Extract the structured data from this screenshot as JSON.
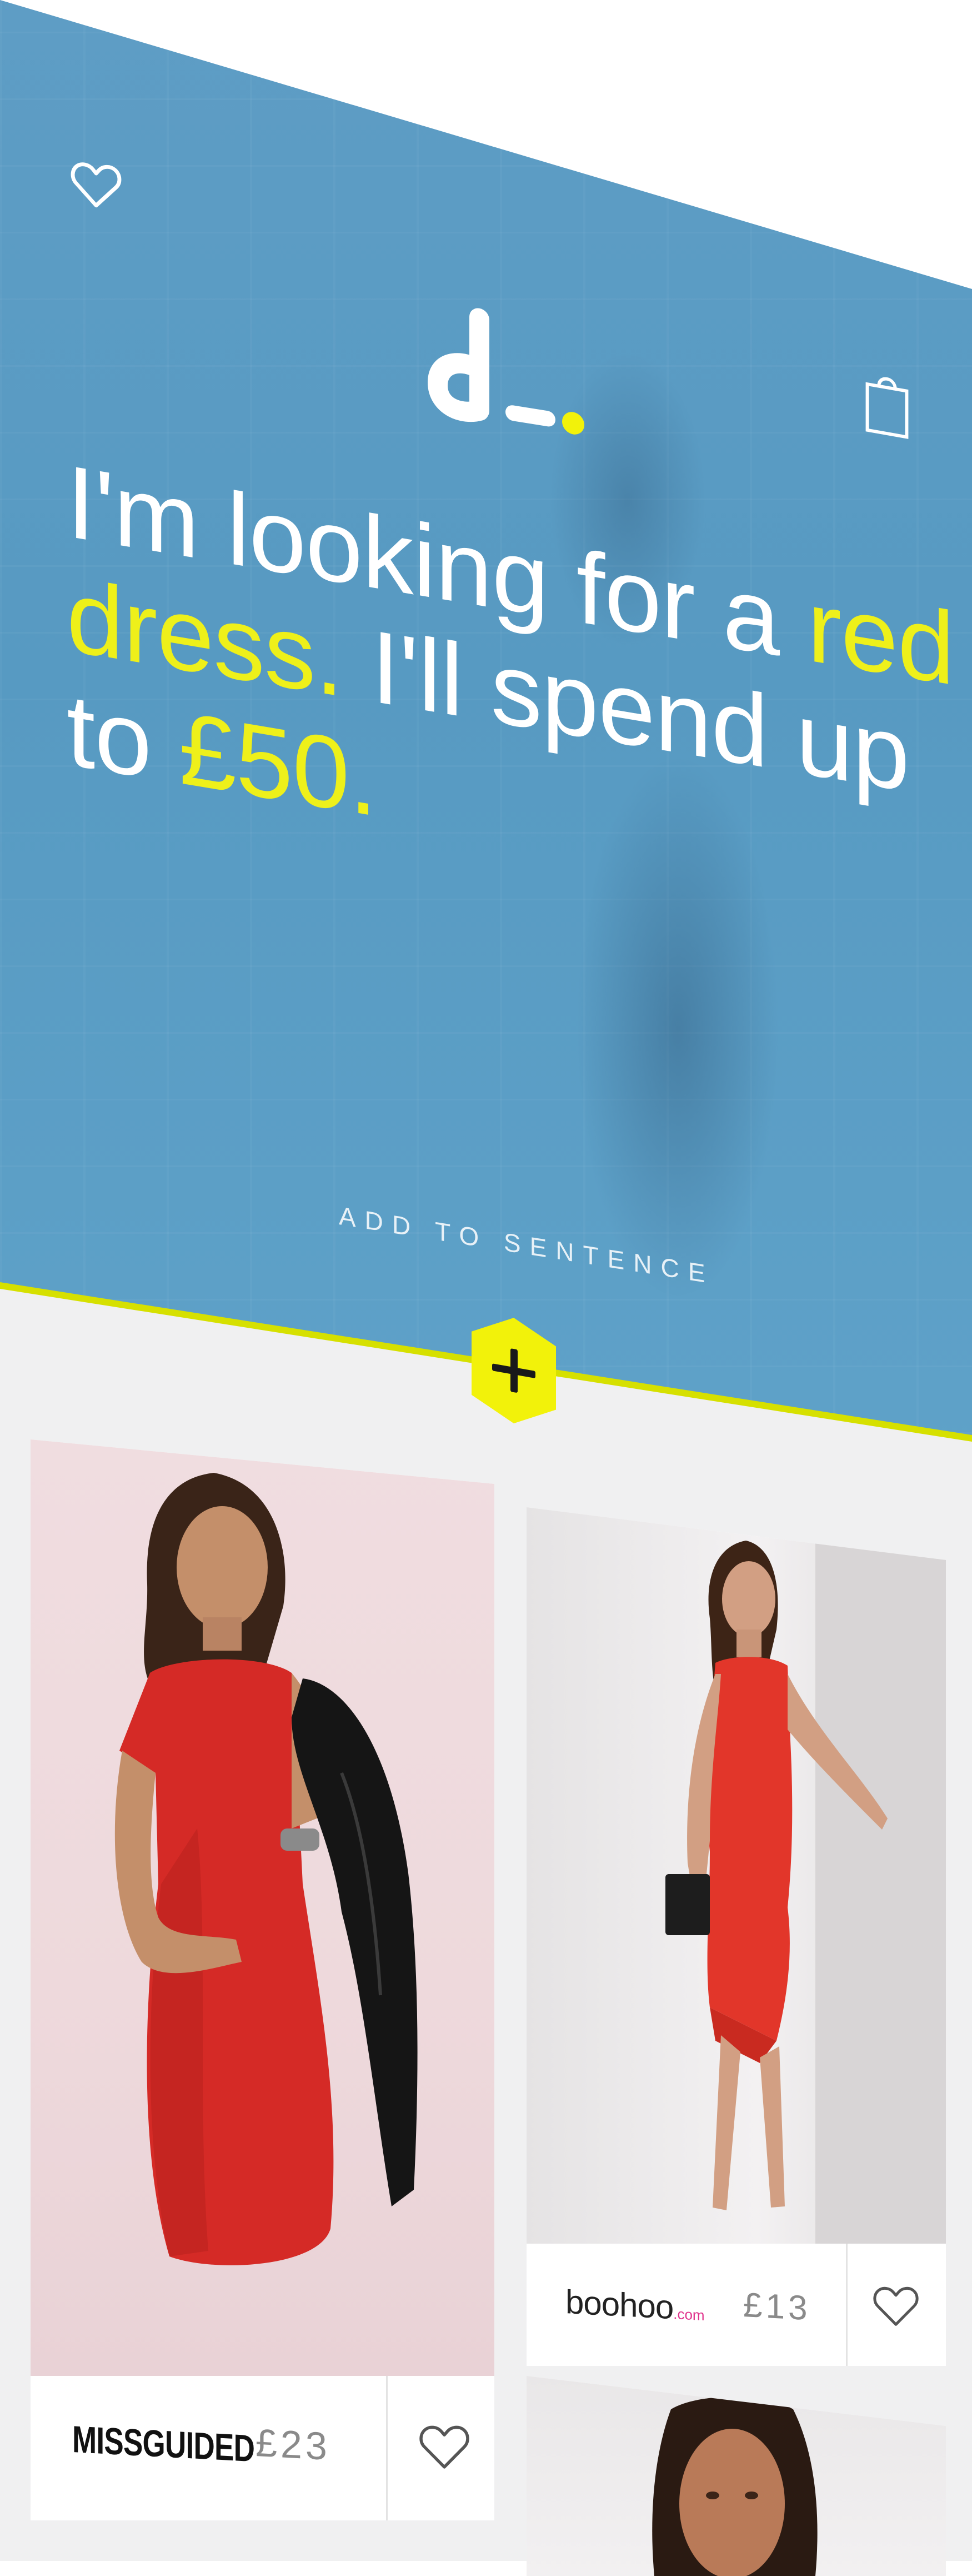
{
  "hero": {
    "sentence": {
      "line1": "I'm looking for a ",
      "line1_highlight": "red",
      "line2_highlight": "dress.",
      "line2": " I'll spend up",
      "line3": "to ",
      "line3_highlight": "£50."
    },
    "add_label": "ADD TO SENTENCE",
    "icons": {
      "favorites": "heart-outline-icon",
      "bag": "shopping-bag-icon",
      "logo": "d-logo",
      "add": "plus-icon"
    }
  },
  "colors": {
    "hero_blue": "#5e9dc5",
    "highlight_yellow": "#eef01a",
    "accent_yellow": "#f2f20a",
    "background": "#f0f0f1",
    "boohoo_pink": "#e0338c"
  },
  "products": [
    {
      "brand": "MISSGUIDED",
      "price": "£23",
      "favorite_icon": "heart-outline-icon",
      "image": "red-dress-with-jacket"
    },
    {
      "brand": "boohoo",
      "brand_suffix": ".com",
      "price": "£13",
      "favorite_icon": "heart-outline-icon",
      "image": "red-halter-dress"
    },
    {
      "image": "model-portrait"
    }
  ]
}
